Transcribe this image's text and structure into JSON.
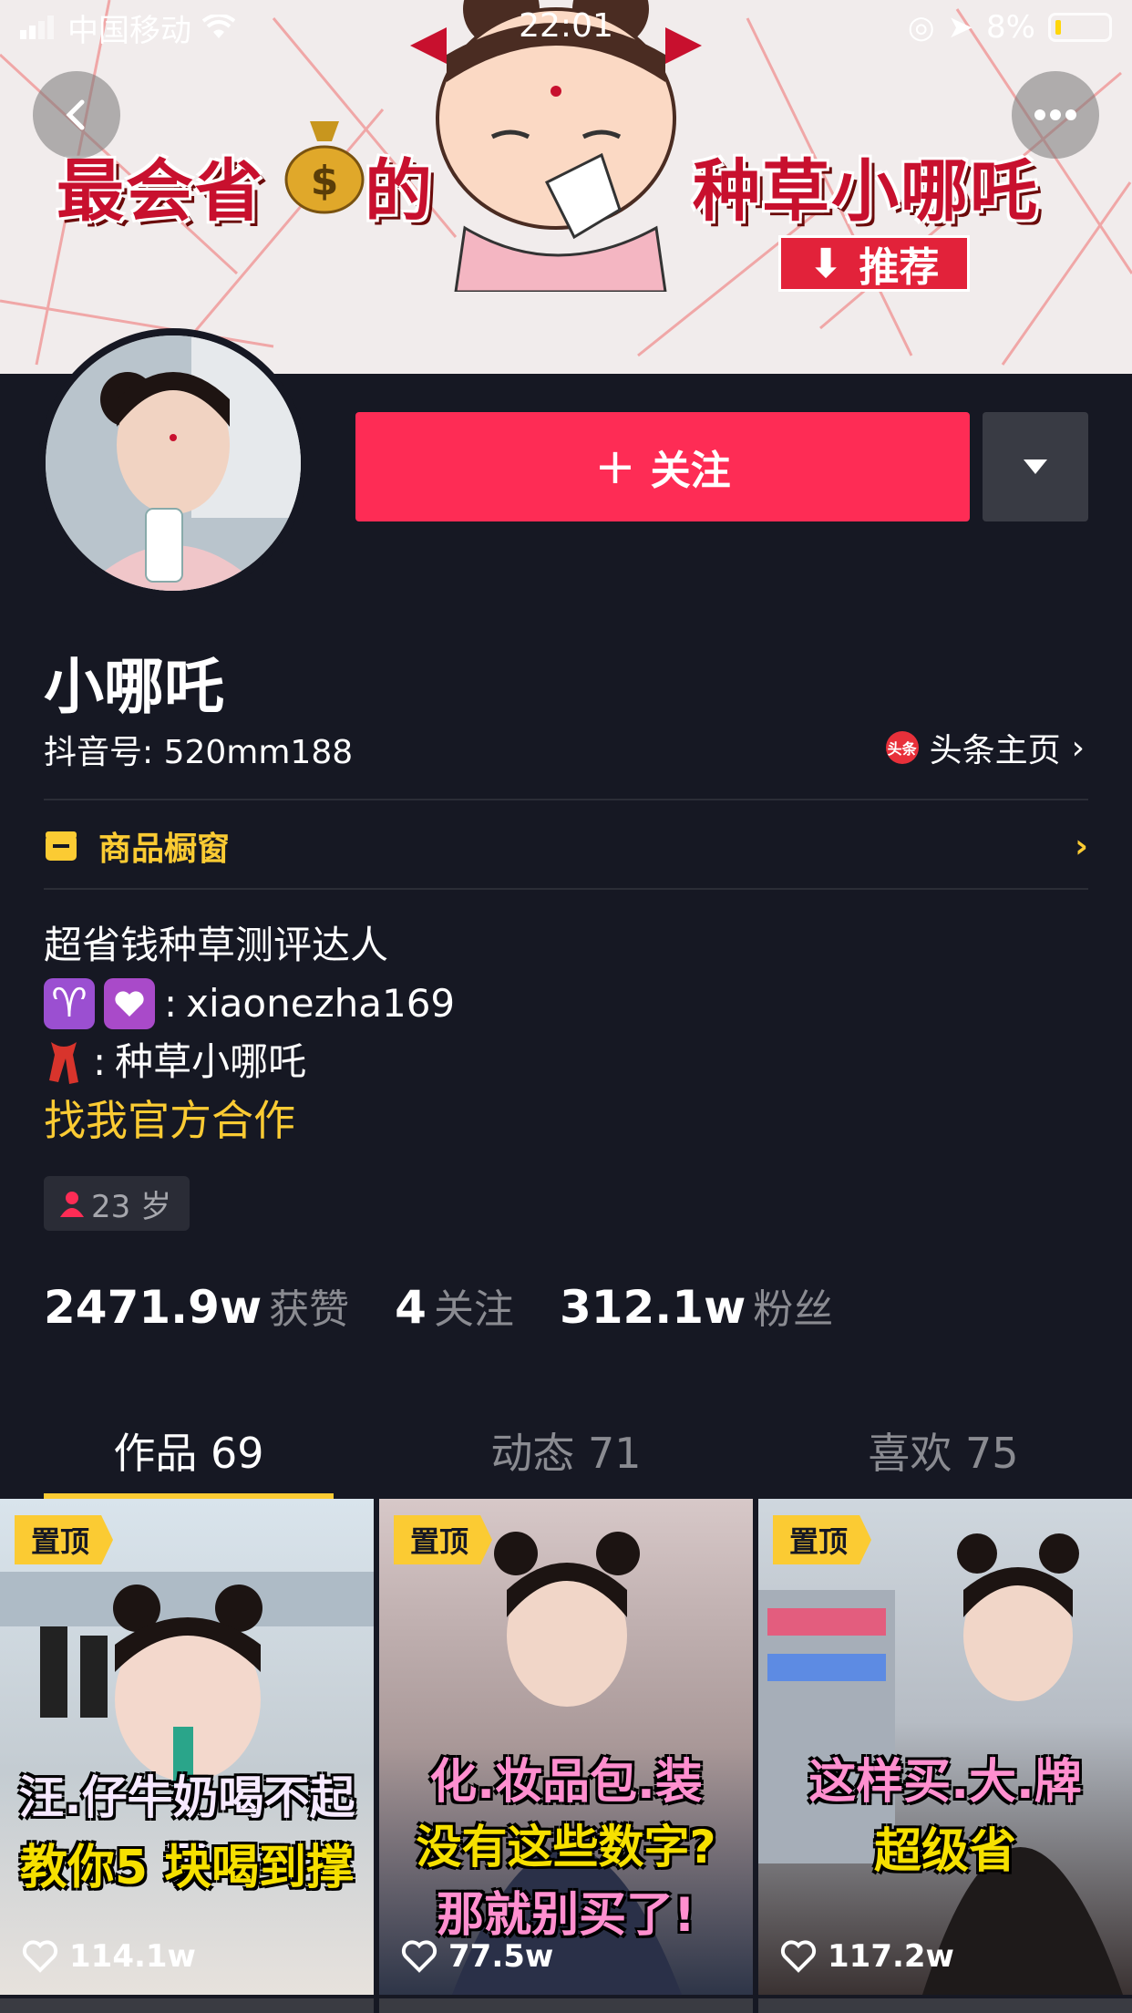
{
  "status_bar": {
    "carrier": "中国移动",
    "time": "22:01",
    "battery": "8%"
  },
  "banner": {
    "title_left": "最会省",
    "title_mid": "的",
    "title_right": "种草小哪吒",
    "recommend_label": "推荐"
  },
  "profile": {
    "follow_label": "关注",
    "username": "小哪吒",
    "douyin_id": "抖音号: 520mm188",
    "toutiao_link": "头条主页",
    "toutiao_badge": "头条",
    "shop_label": "商品橱窗",
    "bio_line1": "超省钱种草测评达人",
    "bio_line2": "xiaonezha169",
    "bio_line3": "种草小哪吒",
    "collab_link": "找我官方合作",
    "age": "23 岁"
  },
  "stats": [
    {
      "value": "2471.9w",
      "label": "获赞"
    },
    {
      "value": "4",
      "label": "关注"
    },
    {
      "value": "312.1w",
      "label": "粉丝"
    }
  ],
  "tabs": [
    {
      "label": "作品 69",
      "active": true
    },
    {
      "label": "动态 71",
      "active": false
    },
    {
      "label": "喜欢 75",
      "active": false
    }
  ],
  "videos": [
    {
      "pin": "置顶",
      "caption1": "汪.仔牛奶喝不起了",
      "caption2": "教你5 块喝到撑",
      "likes": "114.1w"
    },
    {
      "pin": "置顶",
      "caption1": "化.妆品包.装",
      "caption2": "没有这些数字?",
      "caption3": "那就别买了!",
      "likes": "77.5w"
    },
    {
      "pin": "置顶",
      "caption1": "这样买.大.牌",
      "caption2": "超级省",
      "likes": "117.2w"
    }
  ],
  "colors": {
    "accent": "#fe2c55",
    "gold": "#fbcb33",
    "bg": "#161823"
  }
}
